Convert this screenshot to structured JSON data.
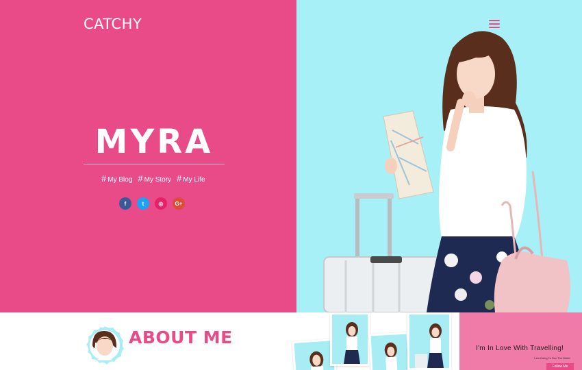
{
  "header": {
    "brand": "CATCHY",
    "menu_icon": "hamburger-menu-icon"
  },
  "hero": {
    "title": "MYRA",
    "tags": [
      {
        "hash": "#",
        "label": "My Blog"
      },
      {
        "hash": "#",
        "label": "My Story"
      },
      {
        "hash": "#",
        "label": "My Life"
      }
    ],
    "socials": [
      {
        "name": "facebook-icon",
        "glyph": "f",
        "color": "#3b5998"
      },
      {
        "name": "twitter-icon",
        "glyph": "t",
        "color": "#1da1f2"
      },
      {
        "name": "dribbble-icon",
        "glyph": "◎",
        "color": "#ea1f6a"
      },
      {
        "name": "google-plus-icon",
        "glyph": "G+",
        "color": "#dd4b39"
      }
    ]
  },
  "about": {
    "title": "ABOUT ME"
  },
  "promo": {
    "title": "I'm In Love With Travelling!",
    "subtitle": "I am Going To See The World",
    "button": "Follow Me"
  },
  "colors": {
    "pink": "#e84b88",
    "cyan": "#a8f0f7",
    "promo_pink": "#f07aa8"
  }
}
